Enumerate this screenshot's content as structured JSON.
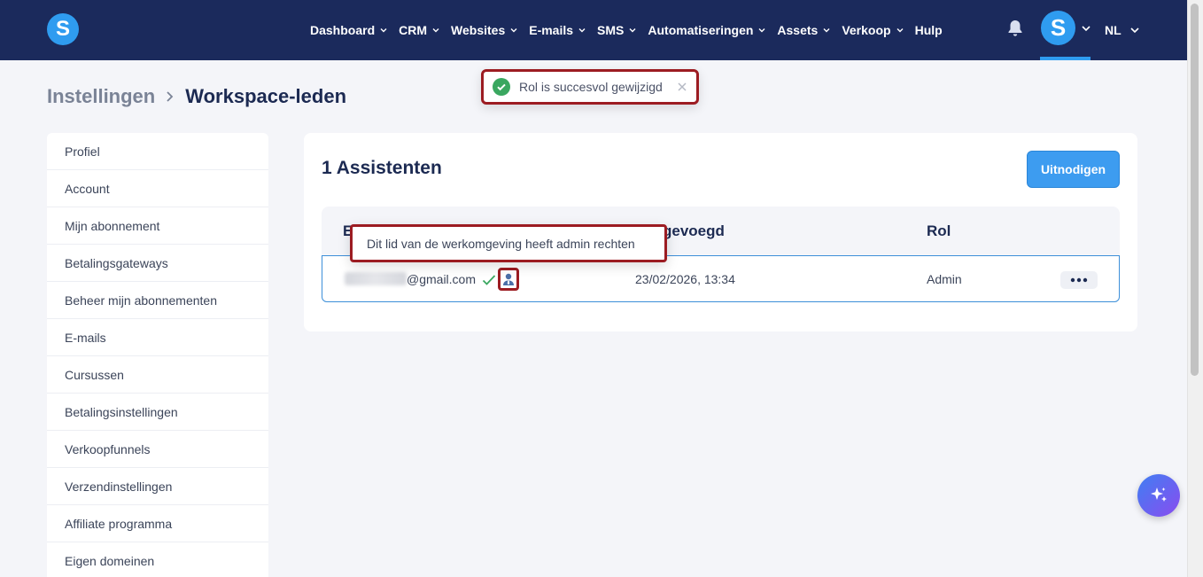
{
  "app": {
    "logo_letter": "S",
    "avatar_letter": "S"
  },
  "nav": {
    "items": [
      {
        "label": "Dashboard",
        "has_dropdown": true
      },
      {
        "label": "CRM",
        "has_dropdown": true
      },
      {
        "label": "Websites",
        "has_dropdown": true
      },
      {
        "label": "E-mails",
        "has_dropdown": true
      },
      {
        "label": "SMS",
        "has_dropdown": true
      },
      {
        "label": "Automatiseringen",
        "has_dropdown": true
      },
      {
        "label": "Assets",
        "has_dropdown": true
      },
      {
        "label": "Verkoop",
        "has_dropdown": true
      },
      {
        "label": "Hulp",
        "has_dropdown": false
      }
    ],
    "language": "NL",
    "icons": [
      "bell-icon",
      "chevron-down-icon"
    ]
  },
  "breadcrumb": {
    "parent": "Instellingen",
    "current": "Workspace-leden"
  },
  "toast": {
    "message": "Rol is succesvol gewijzigd"
  },
  "sidebar": {
    "items": [
      {
        "label": "Profiel"
      },
      {
        "label": "Account"
      },
      {
        "label": "Mijn abonnement"
      },
      {
        "label": "Betalingsgateways"
      },
      {
        "label": "Beheer mijn abonnementen"
      },
      {
        "label": "E-mails"
      },
      {
        "label": "Cursussen"
      },
      {
        "label": "Betalingsinstellingen"
      },
      {
        "label": "Verkoopfunnels"
      },
      {
        "label": "Verzendinstellingen"
      },
      {
        "label": "Affiliate programma"
      },
      {
        "label": "Eigen domeinen"
      }
    ]
  },
  "members": {
    "title": "1 Assistenten",
    "invite_label": "Uitnodigen",
    "columns": {
      "email": "E",
      "added": "gevoegd",
      "role": "Rol"
    },
    "rows": [
      {
        "email_domain": "@gmail.com",
        "added": "23/02/2026, 13:34",
        "role": "Admin"
      }
    ],
    "tooltip": "Dit lid van de werkomgeving heeft admin rechten"
  },
  "colors": {
    "topbar": "#1b2a5c",
    "accent": "#3d9cf0",
    "highlight_border": "#9c1c22",
    "success": "#3aa760"
  }
}
